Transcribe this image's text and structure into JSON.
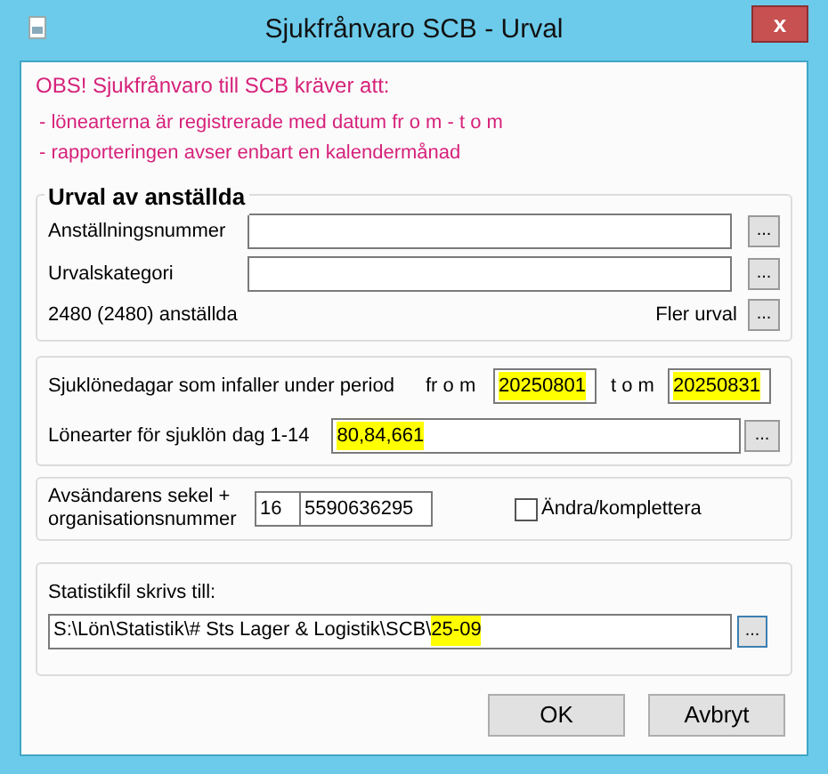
{
  "window": {
    "title": "Sjukfrånvaro SCB - Urval",
    "close": "x"
  },
  "notice": {
    "heading": "OBS! Sjukfrånvaro till SCB kräver att:",
    "lines": [
      "- lönearterna är registrerade med datum fr o m - t o m",
      "- rapporteringen avser enbart en kalendermånad"
    ]
  },
  "employees": {
    "title": "Urval av anställda",
    "fields": [
      {
        "label": "Anställningsnummer",
        "button": "..."
      },
      {
        "label": "Urvalskategori",
        "button": "..."
      }
    ],
    "count": "2480 (2480) anställda",
    "more_label": "Fler urval",
    "more_button": "..."
  },
  "period": {
    "label": "Sjuklönedagar som infaller under period",
    "from_label": "fr o m",
    "from": {
      "value": "20250801",
      "highlighted": true
    },
    "to_label": "t o m",
    "to": {
      "value": "20250831",
      "highlighted": true
    },
    "wage_label": "Lönearter för sjuklön dag 1-14",
    "wage": {
      "value": "80,84,661",
      "highlighted": true
    },
    "wage_button": "..."
  },
  "sender": {
    "label": "Avsändarens sekel + organisationsnummer",
    "century": "16",
    "org_number": "5590636295",
    "amend": {
      "label": "Ändra/komplettera",
      "checked": false
    }
  },
  "output": {
    "label": "Statistikfil skrivs till:",
    "path": "S:\\Lön\\Statistik\\# Sts Lager & Logistik\\SCB\\",
    "path_highlighted": "25-09",
    "button": "..."
  },
  "buttons": [
    "OK",
    "Avbryt"
  ]
}
